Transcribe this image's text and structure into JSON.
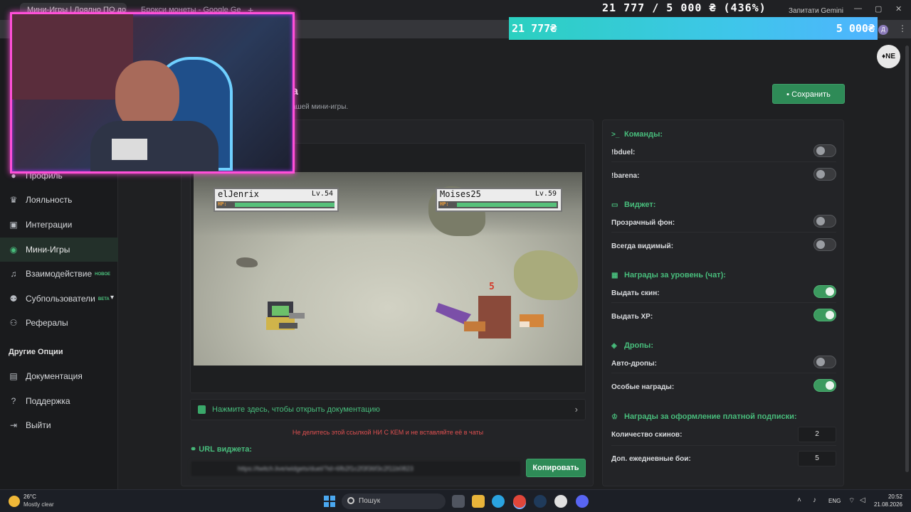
{
  "browser": {
    "tabs": [
      "Мини-Игры | Лоялно ПО до...",
      "Брокси монеты - Google Gem..."
    ],
    "new_tab": "+",
    "gemini_tab": "Запитати Gemini",
    "profile_initial": "Д"
  },
  "donation": {
    "goal_text": "21 777 / 5 000 ₴ (436%)",
    "bar_left": "21 777₴",
    "bar_right": "5 000₴",
    "progress_percent": 436
  },
  "header": {
    "user_badge": "♦NE",
    "title": "а",
    "subtitle": "ашей мини-игры.",
    "save_label": "Сохранить"
  },
  "sidebar": {
    "items": [
      {
        "label": "Профиль",
        "icon": "user-icon"
      },
      {
        "label": "Лояльность",
        "icon": "trophy-icon"
      },
      {
        "label": "Интеграции",
        "icon": "integrations-icon"
      },
      {
        "label": "Мини-Игры",
        "icon": "gamepad-icon",
        "active": true
      },
      {
        "label": "Взаимодействие",
        "icon": "music-icon",
        "badge": "НОВОЕ"
      },
      {
        "label": "Субпользователи",
        "icon": "users-icon",
        "badge": "BETA"
      },
      {
        "label": "Рефералы",
        "icon": "referrals-icon"
      }
    ],
    "section_title": "Другие Опции",
    "other_items": [
      {
        "label": "Документация",
        "icon": "document-icon"
      },
      {
        "label": "Поддержка",
        "icon": "help-icon"
      },
      {
        "label": "Выйти",
        "icon": "logout-icon"
      }
    ]
  },
  "preview": {
    "player1": {
      "name": "elJenrix",
      "level": "Lv.54",
      "hp_tag": "HP:",
      "hp_fraction": 1.0
    },
    "player2": {
      "name": "Moises25",
      "level": "Lv.59",
      "hp_tag": "HP:",
      "hp_fraction": 1.0
    },
    "damage": "5"
  },
  "docs_link": "Нажмите здесь, чтобы открыть документацию",
  "warning": "Не делитесь этой ссылкой НИ С КЕМ и не вставляйте её в чаты",
  "url": {
    "label": "URL виджета:",
    "value": "https://twitch.live/widgets/duel/?id=6fb2f1c2f3f36f3c2f11b0823",
    "copy_label": "Копировать"
  },
  "settings": {
    "commands": {
      "title": "Команды:",
      "rows": [
        {
          "label": "!bduel:",
          "on": false
        },
        {
          "label": "!barena:",
          "on": false
        }
      ]
    },
    "widget": {
      "title": "Виджет:",
      "rows": [
        {
          "label": "Прозрачный фон:",
          "on": false
        },
        {
          "label": "Всегда видимый:",
          "on": false
        }
      ]
    },
    "level_rewards": {
      "title": "Награды за уровень (чат):",
      "rows": [
        {
          "label": "Выдать скин:",
          "on": true
        },
        {
          "label": "Выдать XP:",
          "on": true
        }
      ]
    },
    "drops": {
      "title": "Дропы:",
      "rows": [
        {
          "label": "Авто-дропы:",
          "on": false
        },
        {
          "label": "Особые награды:",
          "on": true
        }
      ]
    },
    "sub_rewards": {
      "title": "Награды за оформление платной подписки:",
      "rows": [
        {
          "label": "Количество скинов:",
          "value": "2"
        },
        {
          "label": "Доп. ежедневные бои:",
          "value": "5"
        }
      ]
    }
  },
  "taskbar": {
    "temp": "26°C",
    "weather": "Mostly clear",
    "search": "Пошук",
    "lang": "ENG",
    "time": "20:52",
    "date": "21.08.2026"
  },
  "colors": {
    "accent": "#2e8b57",
    "accent_text": "#48bd7c",
    "warning": "#e05050",
    "webcam_border": "#ff4fd8"
  }
}
